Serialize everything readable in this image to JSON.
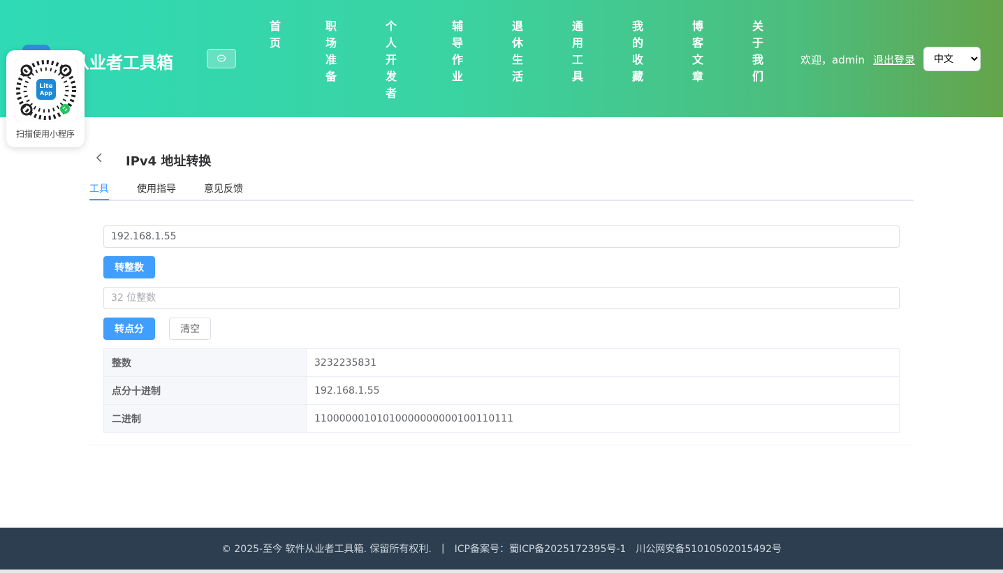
{
  "header": {
    "brand": "件从业者工具箱",
    "nav": [
      {
        "label": "首页"
      },
      {
        "label": "职场准备"
      },
      {
        "label": "个人开发者"
      },
      {
        "label": "辅导作业"
      },
      {
        "label": "退休生活"
      },
      {
        "label": "通用工具"
      },
      {
        "label": "我的收藏"
      },
      {
        "label": "博客文章"
      },
      {
        "label": "关于我们"
      }
    ],
    "welcome": "欢迎，admin",
    "logout": "退出登录",
    "language": "中文"
  },
  "qr": {
    "logo_text_1": "Lite",
    "logo_text_2": "App",
    "caption": "扫描使用小程序"
  },
  "page": {
    "title": "IPv4 地址转换",
    "tabs": [
      "工具",
      "使用指导",
      "意见反馈"
    ],
    "active_tab": "工具"
  },
  "form": {
    "ip_value": "192.168.1.55",
    "to_int_button": "转整数",
    "int_placeholder": "32 位整数",
    "to_dotted_button": "转点分",
    "clear_button": "清空"
  },
  "results": [
    {
      "label": "整数",
      "value": "3232235831"
    },
    {
      "label": "点分十进制",
      "value": "192.168.1.55"
    },
    {
      "label": "二进制",
      "value": "11000000101010000000000100110111"
    }
  ],
  "footer": {
    "copyright": "© 2025-至今 软件从业者工具箱. 保留所有权利.",
    "separator": "|",
    "icp": "ICP备案号：蜀ICP备2025172395号-1",
    "police": "川公网安备51010502015492号"
  },
  "colors": {
    "primary": "#409eff",
    "footer_bg": "#2c3e50",
    "header_gradient_start": "#2fdab6",
    "header_gradient_end": "#64a44a"
  }
}
